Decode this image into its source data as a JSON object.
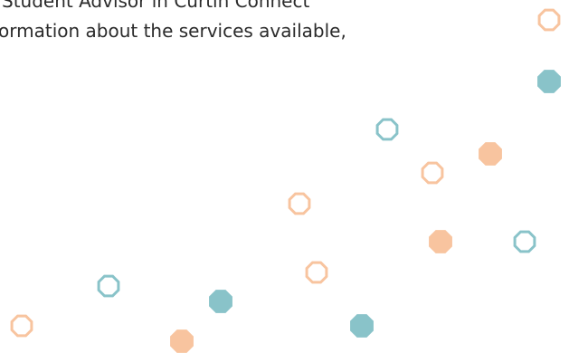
{
  "body_text": {
    "line_1": "Student Advisor in Curtin Connect",
    "line_2": "ormation about the services available,"
  },
  "colors": {
    "peach": "#f8c49f",
    "teal": "#89c3c9",
    "text": "#2b2b2b"
  },
  "decoration": {
    "shape": "octagon",
    "styles": [
      "peach-outline",
      "peach-filled",
      "teal-outline",
      "teal-filled"
    ]
  }
}
